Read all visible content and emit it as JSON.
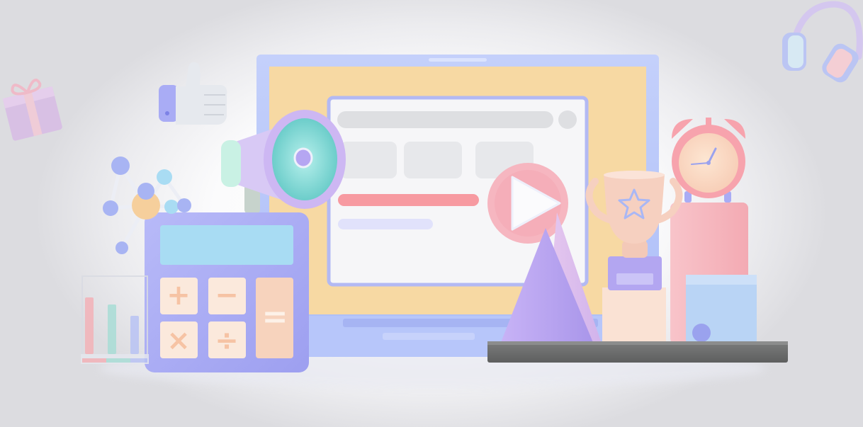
{
  "scene": {
    "kind": "3d-illustration",
    "description_items": [
      "laptop-with-web-page",
      "megaphone",
      "play-button",
      "calculator",
      "trophy",
      "alarm-clock",
      "thumbs-up",
      "gift-box",
      "headphones",
      "molecule",
      "bar-chart",
      "cones",
      "display-shelf"
    ],
    "calculator_keys": [
      "+",
      "−",
      "×",
      "÷",
      "="
    ],
    "colors": {
      "laptop_frame": "#b9c8fb",
      "laptop_screen_bg": "#f7d9a3",
      "browser_window": "#f6f6f8",
      "browser_border": "#b3b9f3",
      "progress_bar": "#f79aa1",
      "calculator_body": "#a9acf5",
      "calculator_display": "#a8dcf3",
      "calculator_key": "#fbe9dc",
      "megaphone_teal": "#84d8d5",
      "megaphone_lilac": "#cdb7f3",
      "play_circle": "#f6b6c0",
      "trophy": "#f6d0c0",
      "clock": "#f7a3ad",
      "shelf": "#6f7070",
      "cone": "#b8a2f0"
    }
  }
}
